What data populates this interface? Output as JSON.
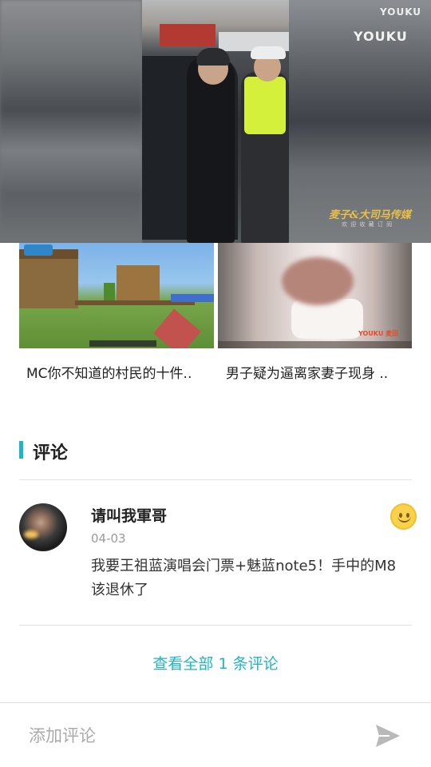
{
  "video": {
    "watermark_top": "YOUKU",
    "watermark_main": "YOUKU",
    "caption": "麦子&大司马传媒",
    "caption_sub": "欢 迎 收 藏 订 阅"
  },
  "related_videos": [
    {
      "title": "MC你不知道的村民的十件..",
      "thumbnail": "minecraft-village"
    },
    {
      "title": "男子疑为逼离家妻子现身 ..",
      "thumbnail": "person-in-bed",
      "thumbnail_logo": "YOUKU 麦田"
    }
  ],
  "comments_section": {
    "title": "评论",
    "comments": [
      {
        "username": "请叫我軍哥",
        "date": "04-03",
        "text": "我要王祖蓝演唱会门票+魅蓝note5！手中的M8该退休了",
        "reaction_icon": "smiley-icon"
      }
    ],
    "view_all_label": "查看全部 1 条评论"
  },
  "input_bar": {
    "placeholder": "添加评论",
    "send_icon": "send-icon"
  },
  "colors": {
    "accent": "#1fb5c6",
    "text_primary": "#222222",
    "text_secondary": "#9a9a9a"
  }
}
